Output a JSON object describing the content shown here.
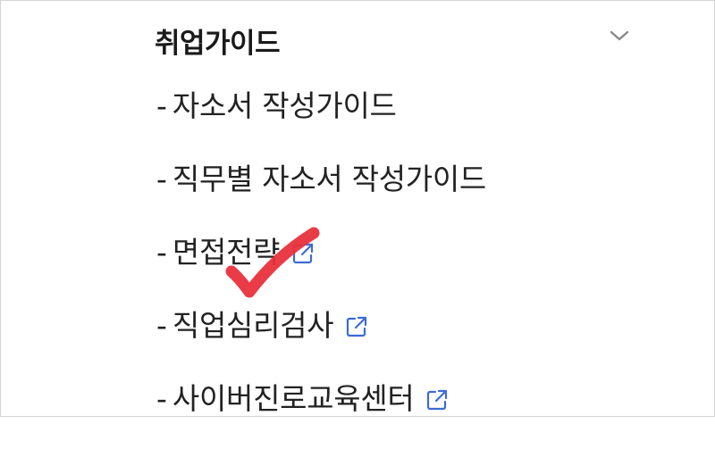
{
  "section": {
    "title": "취업가이드",
    "toggle_icon": "chevron-down-icon"
  },
  "menu": {
    "dash": "-",
    "items": [
      {
        "label": "자소서 작성가이드",
        "external": false
      },
      {
        "label": "직무별 자소서 작성가이드",
        "external": false
      },
      {
        "label": "면접전략",
        "external": true
      },
      {
        "label": "직업심리검사",
        "external": true
      },
      {
        "label": "사이버진로교육센터",
        "external": true
      }
    ]
  },
  "annotation": {
    "icon": "red-checkmark-icon",
    "color": "#e8313d"
  },
  "colors": {
    "external_link_icon": "#3d6bd6",
    "chevron": "#8a8a8a"
  }
}
